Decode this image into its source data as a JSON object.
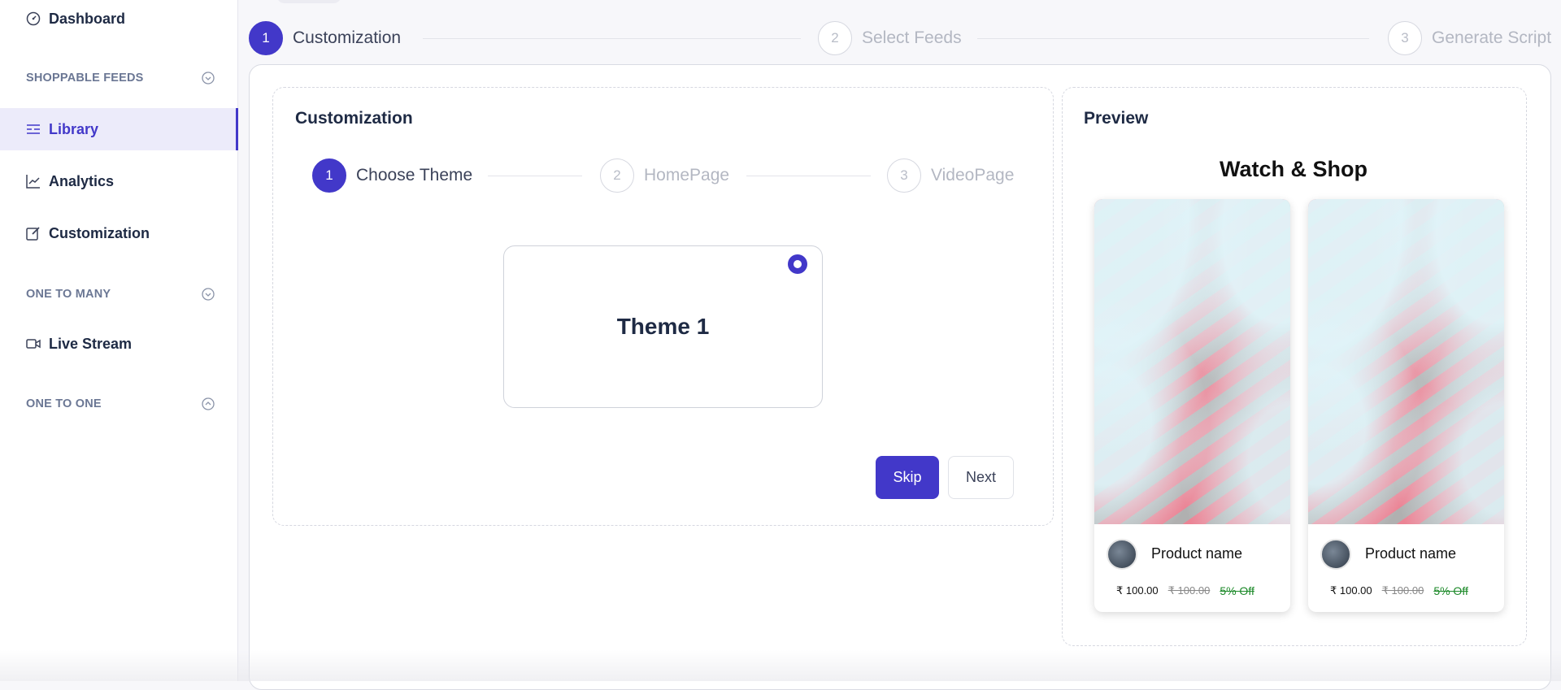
{
  "sidebar": {
    "dashboard": "Dashboard",
    "section_shoppable": "SHOPPABLE FEEDS",
    "library": "Library",
    "analytics": "Analytics",
    "customization": "Customization",
    "section_one_to_many": "ONE TO MANY",
    "live_stream": "Live Stream",
    "section_one_to_one": "ONE TO ONE"
  },
  "top_stepper": [
    {
      "num": "1",
      "label": "Customization",
      "active": true
    },
    {
      "num": "2",
      "label": "Select Feeds",
      "active": false
    },
    {
      "num": "3",
      "label": "Generate Script",
      "active": false
    }
  ],
  "customization_panel": {
    "title": "Customization",
    "steps": [
      {
        "num": "1",
        "label": "Choose Theme",
        "active": true
      },
      {
        "num": "2",
        "label": "HomePage",
        "active": false
      },
      {
        "num": "3",
        "label": "VideoPage",
        "active": false
      }
    ],
    "theme_name": "Theme 1",
    "skip_label": "Skip",
    "next_label": "Next"
  },
  "preview_panel": {
    "title": "Preview",
    "heading": "Watch & Shop",
    "products": [
      {
        "name": "Product name",
        "price": "₹ 100.00",
        "old_price": "₹ 100.00",
        "discount": "5% Off"
      },
      {
        "name": "Product name",
        "price": "₹ 100.00",
        "old_price": "₹ 100.00",
        "discount": "5% Off"
      }
    ]
  },
  "colors": {
    "accent": "#4238c9",
    "text": "#1e2a44",
    "muted": "#b3b7c2",
    "discount": "#1d8a2a"
  }
}
